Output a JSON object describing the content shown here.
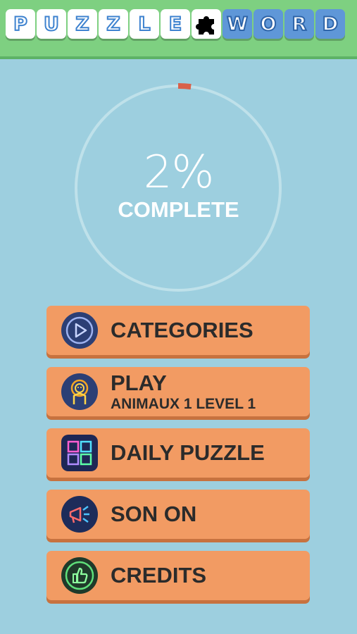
{
  "header": {
    "logo_letters": [
      "P",
      "U",
      "Z",
      "Z",
      "L",
      "E",
      "",
      "W",
      "O",
      "R",
      "D"
    ],
    "logo_icon": "puzzle-piece-icon"
  },
  "progress": {
    "value": 0.02,
    "percent_label": "2%",
    "complete_label": "COMPLETE"
  },
  "menu": {
    "categories": {
      "label": "CATEGORIES",
      "icon": "play-circle-icon"
    },
    "play": {
      "label": "PLAY",
      "sublabel": "ANIMAUX 1 LEVEL 1",
      "icon": "lion-icon"
    },
    "daily_puzzle": {
      "label": "DAILY PUZZLE",
      "icon": "puzzle-icon"
    },
    "sound": {
      "label": "SON ON",
      "icon": "megaphone-icon"
    },
    "credits": {
      "label": "CREDITS",
      "icon": "thumbs-up-icon"
    }
  },
  "colors": {
    "background": "#9dcfdf",
    "header": "#7ed081",
    "button": "#f29b63",
    "progress_accent": "#d9614a"
  }
}
